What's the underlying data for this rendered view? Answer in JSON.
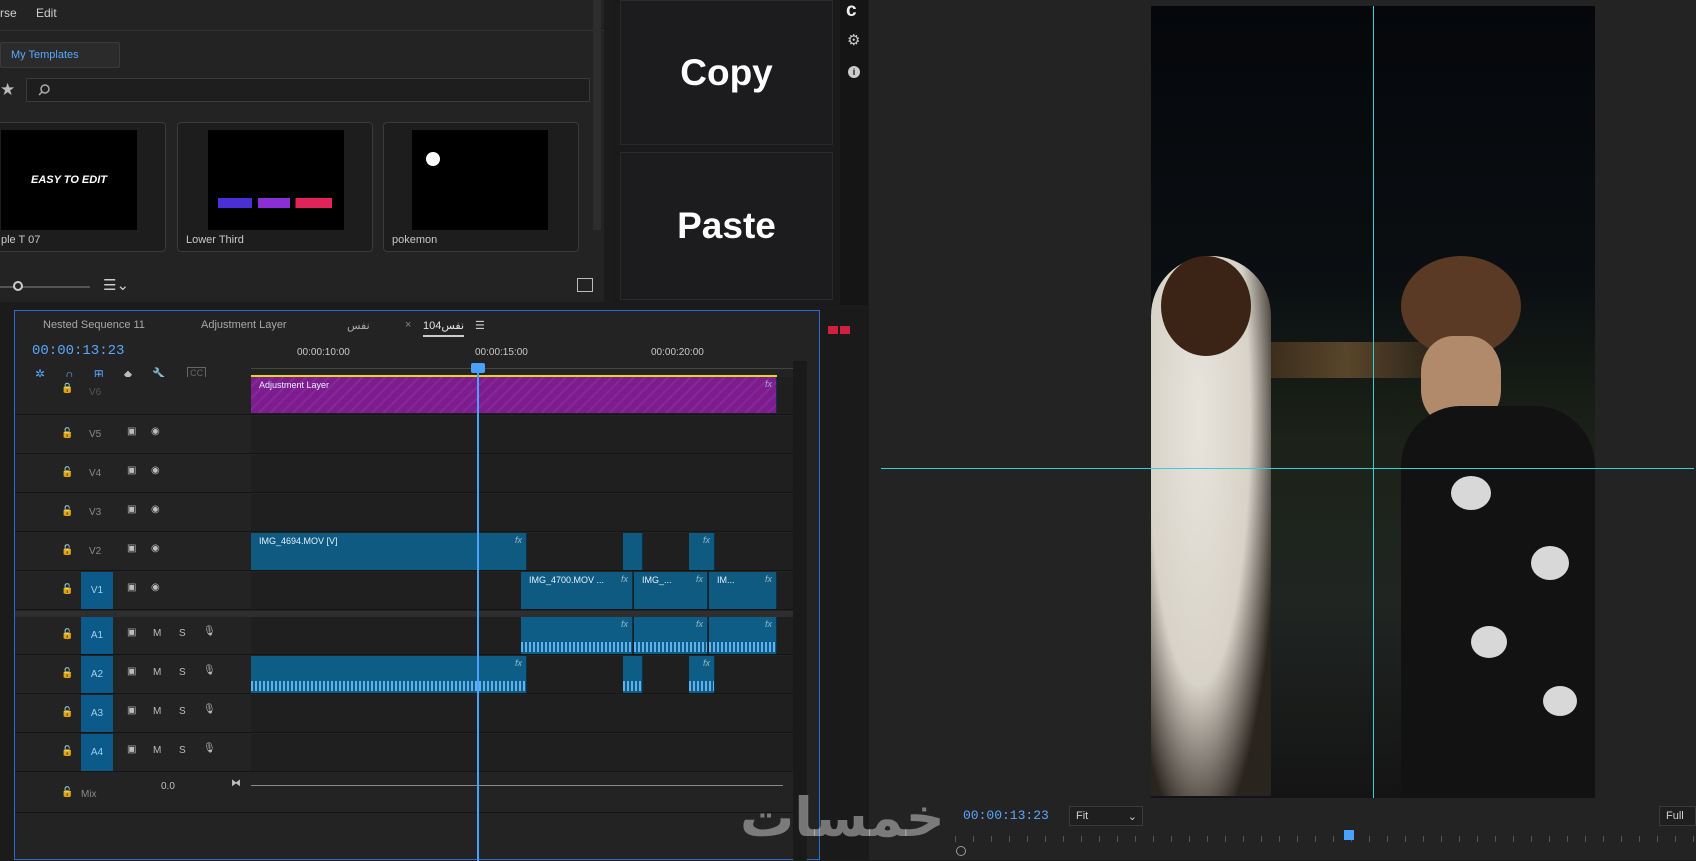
{
  "essential_graphics": {
    "tabs": [
      "rse",
      "Edit"
    ],
    "my_templates_label": "My Templates",
    "search_placeholder": "",
    "templates": [
      {
        "name": "ple T 07",
        "thumb_text": "EASY TO EDIT"
      },
      {
        "name": "Lower Third",
        "thumb_text": ""
      },
      {
        "name": "pokemon",
        "thumb_text": ""
      }
    ]
  },
  "copy_paste": {
    "copy_label": "Copy",
    "paste_label": "Paste"
  },
  "side_icons": [
    "c-logo-icon",
    "gear-icon",
    "info-icon"
  ],
  "timeline": {
    "tabs": [
      {
        "label": "Nested Sequence 11"
      },
      {
        "label": "Adjustment Layer"
      },
      {
        "label": "نفس"
      },
      {
        "label": "نفس104",
        "active": true
      }
    ],
    "timecode": "00:00:13:23",
    "ruler": [
      "00:00:10:00",
      "00:00:15:00",
      "00:00:20:00"
    ],
    "video_tracks": [
      {
        "name": "V6",
        "clips": [
          {
            "label": "Adjustment Layer"
          }
        ]
      },
      {
        "name": "V5",
        "clips": []
      },
      {
        "name": "V4",
        "clips": []
      },
      {
        "name": "V3",
        "clips": []
      },
      {
        "name": "V2",
        "clips": [
          {
            "label": "IMG_4694.MOV [V]"
          }
        ]
      },
      {
        "name": "V1",
        "clips": [
          {
            "label": "IMG_4700.MOV ..."
          },
          {
            "label": "IMG_..."
          },
          {
            "label": "IM..."
          }
        ]
      }
    ],
    "audio_tracks": [
      {
        "name": "A1",
        "m": "M",
        "s": "S"
      },
      {
        "name": "A2",
        "m": "M",
        "s": "S"
      },
      {
        "name": "A3",
        "m": "M",
        "s": "S"
      },
      {
        "name": "A4",
        "m": "M",
        "s": "S"
      }
    ],
    "mix": {
      "name": "Mix",
      "value": "0.0"
    }
  },
  "monitor": {
    "timecode": "00:00:13:23",
    "zoom": "Fit",
    "resolution": "Full",
    "watermark": "خمسات"
  },
  "colors": {
    "accent": "#2b6ad1",
    "playhead": "#5aa6ff",
    "adjustment_clip": "#7b1d8e",
    "video_clip": "#0e5a80",
    "guide": "#35d0d8"
  }
}
